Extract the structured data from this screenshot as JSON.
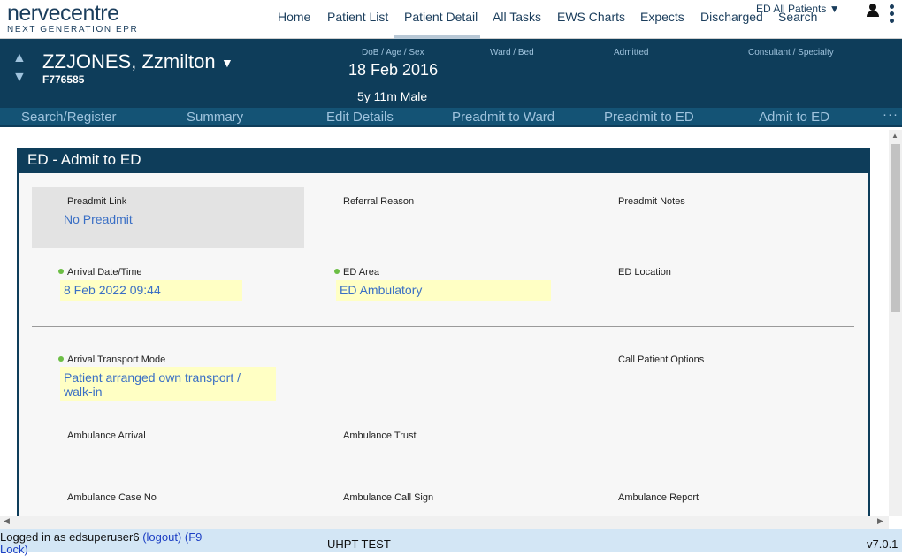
{
  "brand": {
    "name": "nervecentre",
    "tagline": "NEXT GENERATION EPR"
  },
  "nav": {
    "items": [
      "Home",
      "Patient List",
      "Patient Detail",
      "All Tasks",
      "EWS Charts",
      "Expects",
      "Discharged",
      "Search"
    ],
    "active": "Patient Detail",
    "ward_select": "ED All Patients"
  },
  "patient": {
    "name": "ZZJONES, Zzmilton",
    "id": "F776585",
    "labels": {
      "dob": "DoB / Age / Sex",
      "ward": "Ward / Bed",
      "admitted": "Admitted",
      "consultant": "Consultant / Specialty"
    },
    "dob": "18 Feb 2016",
    "age_sex": "5y 11m Male"
  },
  "actions": [
    "Search/Register",
    "Summary",
    "Edit Details",
    "Preadmit to Ward",
    "Preadmit to ED",
    "Admit to ED"
  ],
  "form": {
    "title": "ED - Admit to ED",
    "preadmit_link": {
      "label": "Preadmit Link",
      "value": "No Preadmit"
    },
    "referral_reason": {
      "label": "Referral Reason"
    },
    "preadmit_notes": {
      "label": "Preadmit Notes"
    },
    "arrival_datetime": {
      "label": "Arrival Date/Time",
      "value": "8 Feb 2022 09:44"
    },
    "ed_area": {
      "label": "ED Area",
      "value": "ED Ambulatory"
    },
    "ed_location": {
      "label": "ED Location"
    },
    "arrival_transport": {
      "label": "Arrival Transport Mode",
      "value": "Patient arranged own transport / walk-in"
    },
    "call_patient_options": {
      "label": "Call Patient Options"
    },
    "ambulance_arrival": {
      "label": "Ambulance Arrival"
    },
    "ambulance_trust": {
      "label": "Ambulance Trust"
    },
    "ambulance_case_no": {
      "label": "Ambulance Case No"
    },
    "ambulance_call_sign": {
      "label": "Ambulance Call Sign"
    },
    "ambulance_report": {
      "label": "Ambulance Report"
    }
  },
  "footer": {
    "login_prefix": "Logged in as edsuperuser6",
    "logout": "(logout)",
    "lock": "(F9 Lock)",
    "environment": "UHPT TEST",
    "version": "v7.0.1"
  },
  "colors": {
    "banner": "#0e3d5a",
    "actionbar": "#145375",
    "required_dot": "#6cbe45",
    "field_highlight": "#ffffc4",
    "link": "#3a6fc5"
  }
}
